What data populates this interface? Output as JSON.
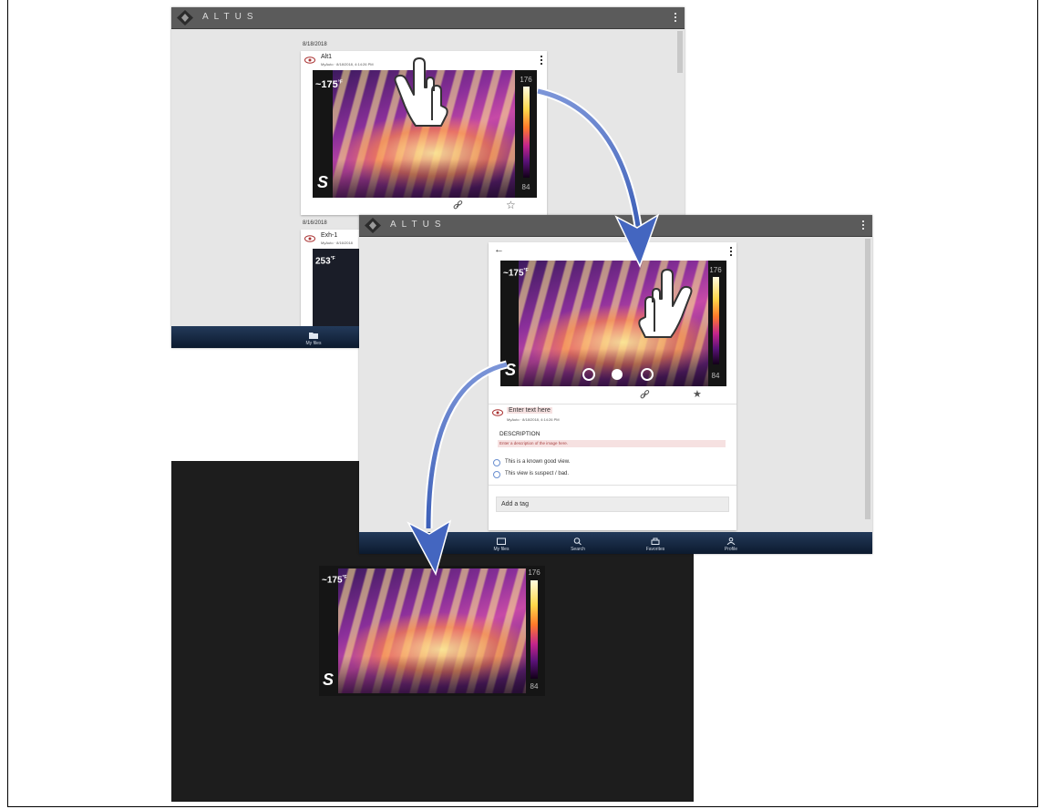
{
  "app": {
    "brand": "ALTUS"
  },
  "window1": {
    "items": [
      {
        "date": "8/18/2018",
        "name": "Alt1",
        "meta": "MyAuto · 8/18/2018, 4:14:26 PM",
        "temp": "~175",
        "unit": "°F",
        "scale_max": "176",
        "scale_min": "84"
      },
      {
        "date": "8/16/2018",
        "name": "Exh-1",
        "meta": "MyAuto · 8/16/2018",
        "temp": "253",
        "unit": "°F"
      }
    ],
    "nav": {
      "my_files": "My files"
    }
  },
  "window2": {
    "temp": "~175",
    "unit": "°F",
    "scale_max": "176",
    "scale_min": "84",
    "title_placeholder": "Enter text here",
    "meta": "MyAuto · 8/18/2018, 4:14:26 PM",
    "description_label": "DESCRIPTION",
    "description_placeholder": "Enter a description of the image here.",
    "option_good": "This is a known good view.",
    "option_bad": "This view is suspect / bad.",
    "tag_placeholder": "Add a tag",
    "nav": {
      "my_files": "My files",
      "search": "Search",
      "favorites": "Favorites",
      "profile": "Profile"
    }
  },
  "fullscreen": {
    "temp": "~175",
    "unit": "°F",
    "scale_max": "176",
    "scale_min": "84"
  },
  "logo_text": "S"
}
